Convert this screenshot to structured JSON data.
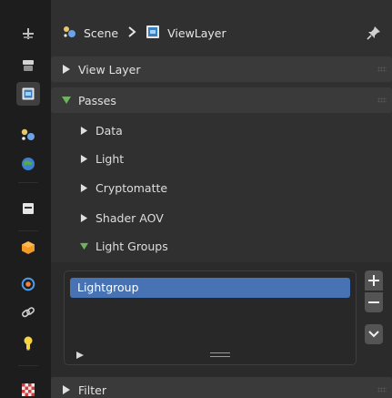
{
  "breadcrumb": {
    "scene_label": "Scene",
    "view_layer_label": "ViewLayer"
  },
  "panels": {
    "view_layer": {
      "label": "View Layer",
      "expanded": false
    },
    "passes": {
      "label": "Passes",
      "expanded": true
    },
    "filter": {
      "label": "Filter",
      "expanded": false
    }
  },
  "subpanels": [
    {
      "label": "Data",
      "expanded": false
    },
    {
      "label": "Light",
      "expanded": false
    },
    {
      "label": "Cryptomatte",
      "expanded": false
    },
    {
      "label": "Shader AOV",
      "expanded": false
    },
    {
      "label": "Light Groups",
      "expanded": true
    }
  ],
  "lightgroups": {
    "items": [
      {
        "name": "Lightgroup",
        "selected": true
      }
    ]
  },
  "tabs": [
    {
      "icon": "tool-icon"
    },
    {
      "icon": "render-icon"
    },
    {
      "icon": "view-layer-icon",
      "active": true
    },
    {
      "icon": "scene-icon"
    },
    {
      "icon": "world-icon"
    },
    {
      "icon": "collection-icon"
    },
    {
      "icon": "object-icon"
    },
    {
      "icon": "physics-icon"
    },
    {
      "icon": "constraints-icon"
    },
    {
      "icon": "object-data-icon"
    },
    {
      "icon": "texture-icon"
    }
  ],
  "colors": {
    "accent": "#4772b3",
    "expanded_triangle": "#70b25d",
    "panel_bg": "#303030",
    "header_bg": "#3a3a3a"
  }
}
